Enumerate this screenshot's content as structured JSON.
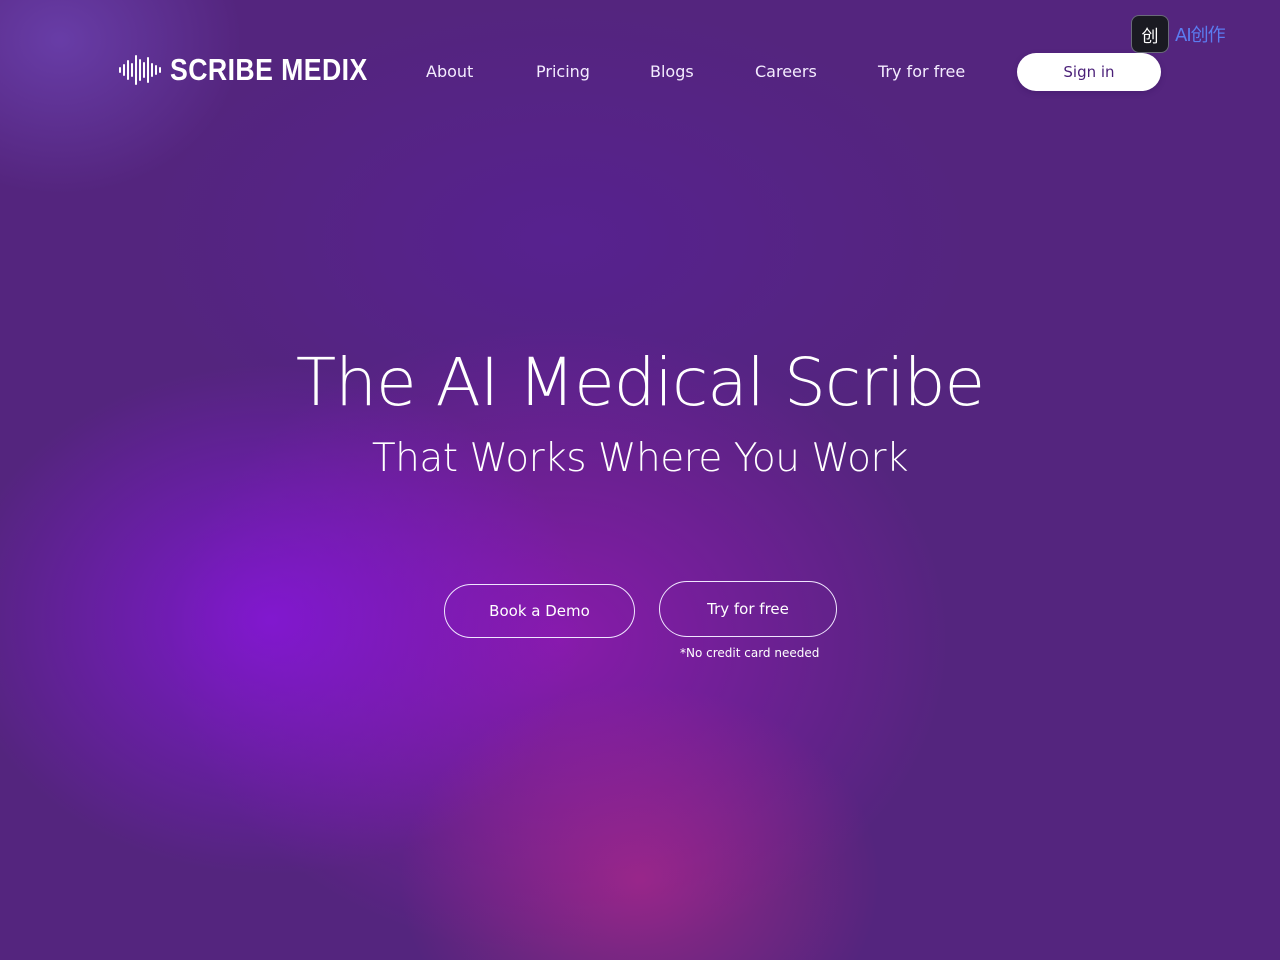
{
  "header": {
    "logo_text": "SCRIBE MEDIX",
    "nav": [
      {
        "label": "About"
      },
      {
        "label": "Pricing"
      },
      {
        "label": "Blogs"
      },
      {
        "label": "Careers"
      },
      {
        "label": "Try for free"
      }
    ],
    "sign_in_label": "Sign in"
  },
  "badge": {
    "icon_glyph": "创",
    "text": "AI创作"
  },
  "hero": {
    "title": "The AI Medical Scribe",
    "subtitle": "That Works Where You Work",
    "demo_button_label": "Book a Demo",
    "try_button_label": "Try for free",
    "note": "*No credit card needed"
  },
  "icons": {
    "logo_mark": "sound-wave-icon",
    "badge": "ai-creation-app-icon"
  },
  "colors": {
    "background": "#54257e",
    "accent_glow_violet": "#8c14e6",
    "accent_glow_magenta": "#c8288c",
    "sign_in_text": "#4a1f78",
    "badge_text": "#5b7cf0"
  }
}
